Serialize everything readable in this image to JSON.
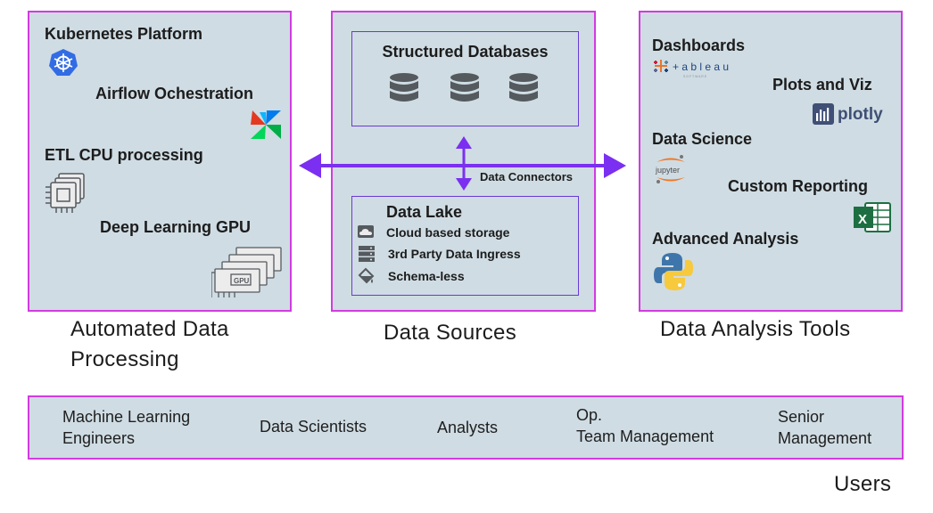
{
  "processing": {
    "items": {
      "kubernetes": "Kubernetes Platform",
      "airflow": "Airflow Ochestration",
      "etl": "ETL CPU processing",
      "deep_learning": "Deep Learning GPU"
    },
    "caption_line1": "Automated Data",
    "caption_line2": "Processing"
  },
  "sources": {
    "structured_title": "Structured Databases",
    "connectors_label": "Data Connectors",
    "lake": {
      "title": "Data Lake",
      "features": [
        "Cloud based storage",
        "3rd Party Data Ingress",
        "Schema-less"
      ]
    },
    "caption": "Data Sources"
  },
  "tools": {
    "items": {
      "dashboards": "Dashboards",
      "plots": "Plots and Viz",
      "data_science": "Data Science",
      "custom_reporting": "Custom Reporting",
      "advanced": "Advanced Analysis"
    },
    "logos": {
      "tableau": "+ a b l e a u",
      "tableau_sub": "S O F T W A R E",
      "plotly": "plotly",
      "jupyter": "jupyter",
      "excel": "X"
    },
    "caption": "Data Analysis Tools"
  },
  "users": {
    "items": [
      [
        "Machine Learning",
        "Engineers"
      ],
      [
        "Data Scientists"
      ],
      [
        "Analysts"
      ],
      [
        "Op.",
        "Team Management"
      ],
      [
        "Senior",
        "Management"
      ]
    ],
    "caption": "Users"
  },
  "colors": {
    "panel_fill": "#cfdce3",
    "panel_border": "#d23be0",
    "inner_border": "#6a3ad6",
    "arrow": "#7b2ff0",
    "icon_gray": "#555a5e"
  }
}
